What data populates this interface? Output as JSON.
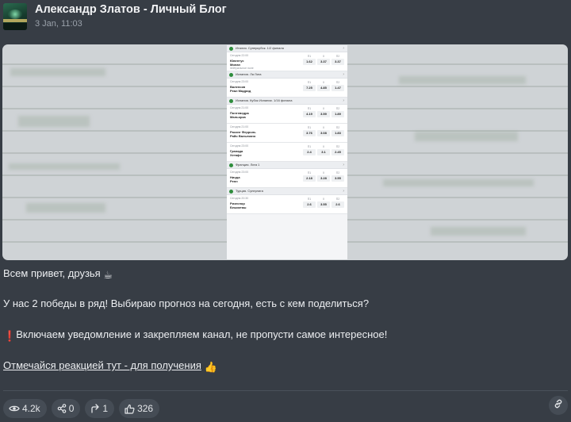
{
  "channel": {
    "title": "Александр Златов - Личный Блог",
    "date": "3 Jan, 11:03"
  },
  "screenshot_leagues": [
    {
      "name": "Италия. Суперкубок. 1/2 финала",
      "matches": [
        {
          "time": "Сегодня 22:00",
          "team1": "Ювентус",
          "team2": "Милан",
          "note": "нейтральное поле",
          "odds": [
            "1.62",
            "3.37",
            "3.37"
          ]
        }
      ]
    },
    {
      "name": "Испания. Ла Лига",
      "matches": [
        {
          "time": "Сегодня 23:00",
          "team1": "Валенсия",
          "team2": "Реал Мадрид",
          "note": "",
          "odds": [
            "7.25",
            "4.85",
            "1.47"
          ]
        }
      ]
    },
    {
      "name": "Испания. Кубок Испании. 1/16 финала",
      "matches": [
        {
          "time": "Сегодня 21:00",
          "team1": "Понтеведра",
          "team2": "Мальорка",
          "note": "",
          "odds": [
            "4.19",
            "3.59",
            "1.89"
          ]
        },
        {
          "time": "Сегодня 21:00",
          "team1": "Расинг Ферроль",
          "team2": "Райо Вальекано",
          "note": "",
          "odds": [
            "3.76",
            "3.08",
            "1.83"
          ]
        },
        {
          "time": "Сегодня 23:00",
          "team1": "Гранада",
          "team2": "Хетафе",
          "note": "",
          "odds": [
            "2.4",
            "3.1",
            "2.45"
          ]
        }
      ]
    },
    {
      "name": "Франция. Лига 1",
      "matches": [
        {
          "time": "Сегодня 23:00",
          "team1": "Ницца",
          "team2": "Ренн",
          "note": "",
          "odds": [
            "2.18",
            "3.28",
            "3.55"
          ]
        }
      ]
    },
    {
      "name": "Турция. Суперлига",
      "matches": [
        {
          "time": "Сегодня 20:30",
          "team1": "Ризеспор",
          "team2": "Бешикташ",
          "note": "",
          "odds": [
            "2.6",
            "3.55",
            "2.6"
          ]
        }
      ]
    }
  ],
  "odds_headers": [
    "П1",
    "Х",
    "П2"
  ],
  "post": {
    "line1": "Всем привет, друзья",
    "line1_emoji": "☕",
    "line2": "У нас 2 победы в ряд! Выбираю прогноз на сегодня, есть с кем поделиться?",
    "line3_emoji": "❗",
    "line3": "Включаем уведомление и закрепляем канал, не пропусти самое интересное!",
    "line4_link": "Отмечайся реакцией тут - для получения",
    "line4_emoji": "👍"
  },
  "footer": {
    "views": "4.2k",
    "shares": "0",
    "forwards": "1",
    "likes": "326",
    "view_icon": "eye-icon",
    "share_icon": "share-icon",
    "forward_icon": "forward-icon",
    "like_icon": "thumbs-up-icon",
    "link_icon": "link-icon"
  },
  "colors": {
    "background": "#373d45",
    "pill": "#454c55",
    "league_icon": "#2f8d3d"
  }
}
